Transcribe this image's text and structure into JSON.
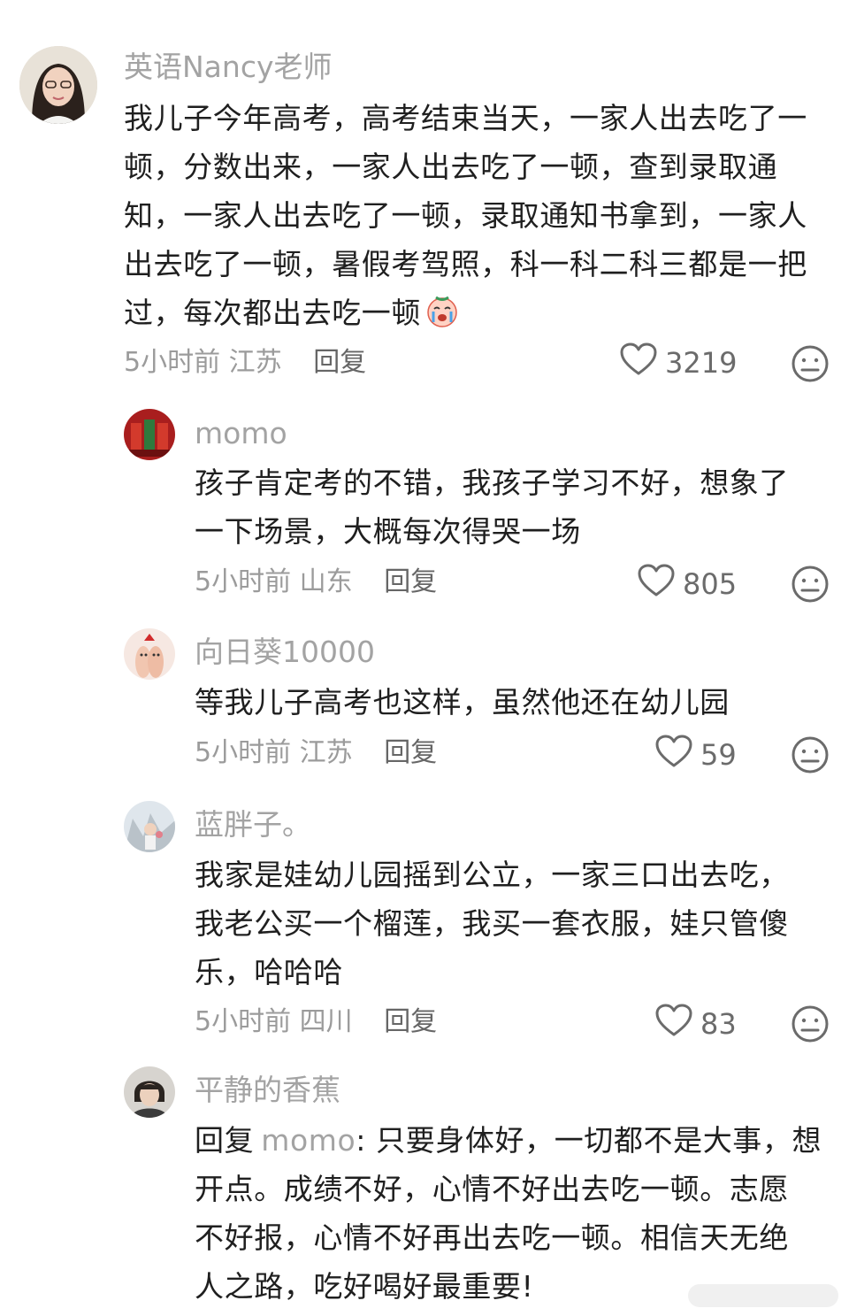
{
  "comments": [
    {
      "user": "英语Nancy老师",
      "lines": [
        "我儿子今年高考，高考结束当天，一家人出去吃了一",
        "顿，分数出来，一家人出去吃了一顿，查到录取通",
        "知，一家人出去吃了一顿，录取通知书拿到，一家人",
        "出去吃了一顿，暑假考驾照，科一科二科三都是一把",
        "过，每次都出去吃一顿"
      ],
      "emoji": "crying-face-emoji",
      "time": "5小时前",
      "location": "江苏",
      "reply": "回复",
      "likes": "3219"
    },
    {
      "user": "momo",
      "lines": [
        "孩子肯定考的不错，我孩子学习不好，想象了",
        "一下场景，大概每次得哭一场"
      ],
      "time": "5小时前",
      "location": "山东",
      "reply": "回复",
      "likes": "805"
    },
    {
      "user": "向日葵10000",
      "lines": [
        "等我儿子高考也这样，虽然他还在幼儿园"
      ],
      "time": "5小时前",
      "location": "江苏",
      "reply": "回复",
      "likes": "59"
    },
    {
      "user": "蓝胖子。",
      "lines": [
        "我家是娃幼儿园摇到公立，一家三口出去吃，",
        "我老公买一个榴莲，我买一套衣服，娃只管傻",
        "乐，哈哈哈"
      ],
      "time": "5小时前",
      "location": "四川",
      "reply": "回复",
      "likes": "83"
    },
    {
      "user": "平静的香蕉",
      "reply_prefix": "回复",
      "reply_to": "momo",
      "reply_first_line": ": 只要身体好，一切都不是大事，想",
      "lines": [
        "开点。成绩不好，心情不好出去吃一顿。志愿",
        "不好报，心情不好再出去吃一顿。相信天无绝",
        "人之路，吃好喝好最重要!"
      ]
    }
  ],
  "colors": {
    "text": "#1f1f1f",
    "muted": "#a3a3a3",
    "reply": "#666666",
    "icon": "#6b6b6b"
  }
}
